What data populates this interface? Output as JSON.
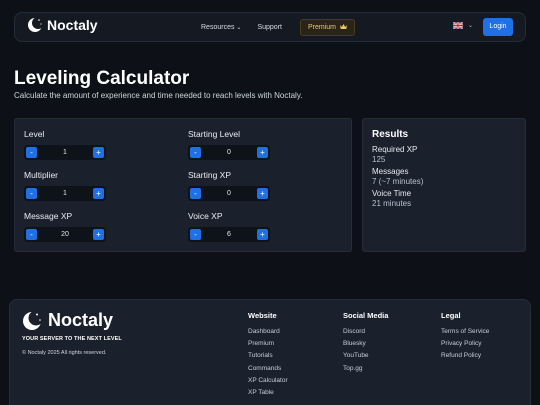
{
  "nav": {
    "logo_text": "Noctaly",
    "resources_label": "Resources",
    "resources_chevron": "⌄",
    "support_label": "Support",
    "premium_label": "Premium",
    "premium_icon": "crown-icon",
    "lang_chevron": "⌄",
    "login_label": "Login"
  },
  "hero": {
    "title": "Leveling Calculator",
    "subtitle": "Calculate the amount of experience and time needed to reach levels with Noctaly."
  },
  "calculator": {
    "level": {
      "label": "Level",
      "value": "1"
    },
    "starting_level": {
      "label": "Starting Level",
      "value": "0"
    },
    "multiplier": {
      "label": "Multiplier",
      "value": "1"
    },
    "starting_xp": {
      "label": "Starting XP",
      "value": "0"
    },
    "message_xp": {
      "label": "Message XP",
      "value": "20"
    },
    "voice_xp": {
      "label": "Voice XP",
      "value": "6"
    },
    "minus_symbol": "-",
    "plus_symbol": "+"
  },
  "results": {
    "title": "Results",
    "required_xp_label": "Required XP",
    "required_xp_value": "125",
    "messages_label": "Messages",
    "messages_value": "7 (~7 minutes)",
    "voice_time_label": "Voice Time",
    "voice_time_value": "21 minutes"
  },
  "footer": {
    "logo_text": "Noctaly",
    "tagline": "YOUR SERVER TO THE NEXT LEVEL",
    "copyright": "© Noctaly 2025 All rights reserved.",
    "website": {
      "title": "Website",
      "links": [
        "Dashboard",
        "Premium",
        "Tutorials",
        "Commands",
        "XP Calculator",
        "XP Table"
      ]
    },
    "social": {
      "title": "Social Media",
      "links": [
        "Discord",
        "Bluesky",
        "YouTube",
        "Top.gg"
      ]
    },
    "legal": {
      "title": "Legal",
      "links": [
        "Terms of Service",
        "Privacy Policy",
        "Refund Policy"
      ]
    }
  },
  "colors": {
    "background": "#0d1117",
    "panel": "#1b212c",
    "accent": "#1f6fe5",
    "premium_gold": "#e8c86a"
  }
}
